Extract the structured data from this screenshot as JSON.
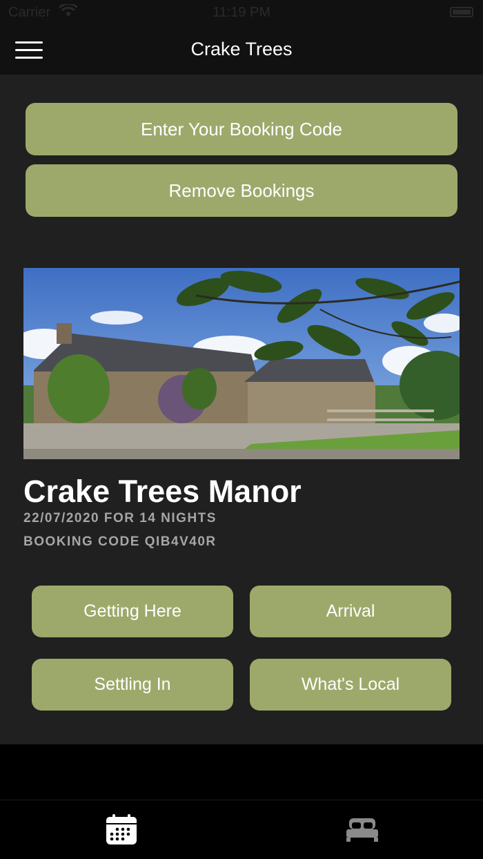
{
  "status_bar": {
    "carrier": "Carrier",
    "time": "11:19 PM"
  },
  "nav": {
    "title": "Crake Trees",
    "menu_icon": "hamburger-menu-icon"
  },
  "actions": {
    "enter_code": "Enter Your Booking Code",
    "remove_bookings": "Remove Bookings"
  },
  "booking": {
    "property_name": "Crake Trees Manor",
    "dates": "22/07/2020 FOR 14 NIGHTS",
    "code": "BOOKING CODE QIB4V40R"
  },
  "sections": {
    "getting_here": "Getting Here",
    "arrival": "Arrival",
    "settling_in": "Settling In",
    "whats_local": "What's Local"
  },
  "tabs": [
    {
      "icon": "calendar-icon",
      "active": true
    },
    {
      "icon": "bed-icon",
      "active": false
    }
  ],
  "colors": {
    "accent": "#9ca96b",
    "background": "#202020",
    "bar": "#111111",
    "muted_text": "#a6a6a6",
    "inactive_tab": "#8a8a8a"
  }
}
